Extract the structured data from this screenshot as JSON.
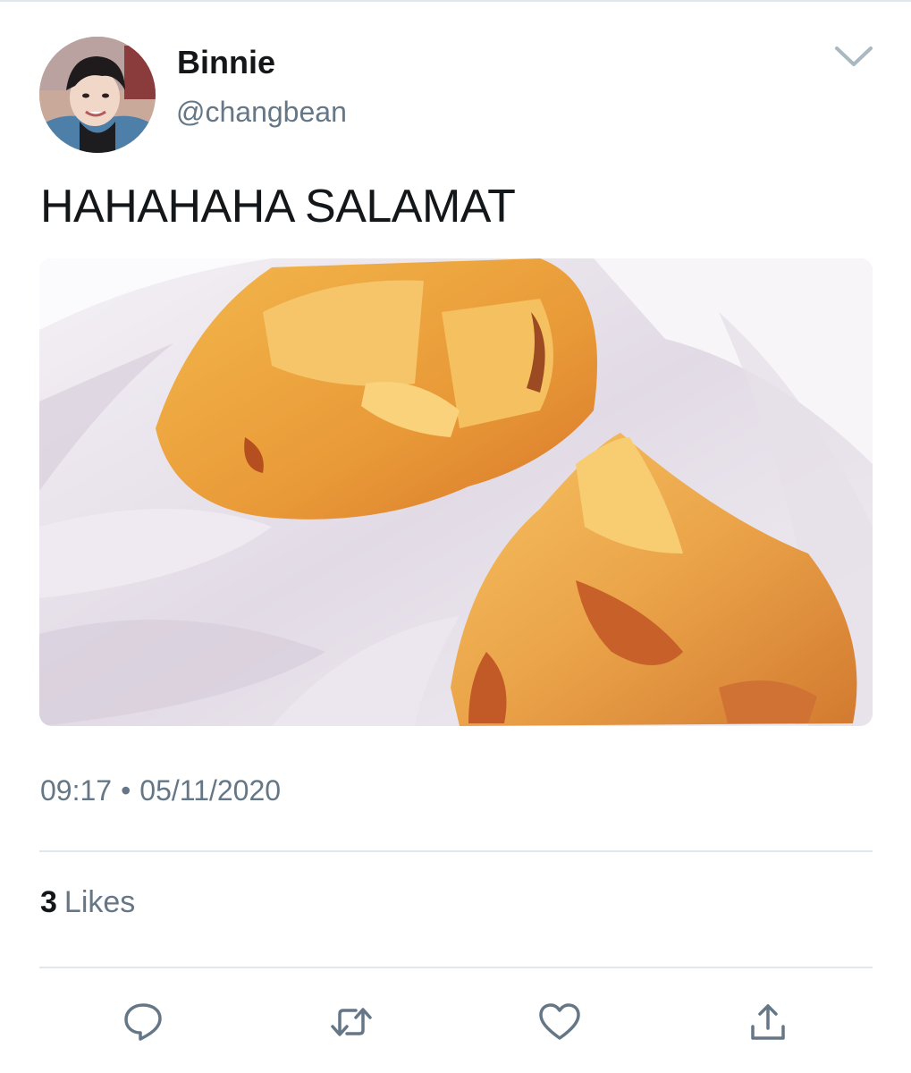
{
  "tweet": {
    "display_name": "Binnie",
    "handle": "@changbean",
    "text": "HAHAHAHA SALAMAT",
    "time": "09:17",
    "separator": "•",
    "date": "05/11/2020",
    "likes_count": "3",
    "likes_label": "Likes"
  },
  "icons": {
    "more": "chevron-down-icon",
    "reply": "reply-icon",
    "retweet": "retweet-icon",
    "like": "heart-icon",
    "share": "share-icon"
  },
  "colors": {
    "text_primary": "#14171a",
    "text_secondary": "#657786",
    "divider": "#e1e8ed",
    "icon": "#657786"
  }
}
